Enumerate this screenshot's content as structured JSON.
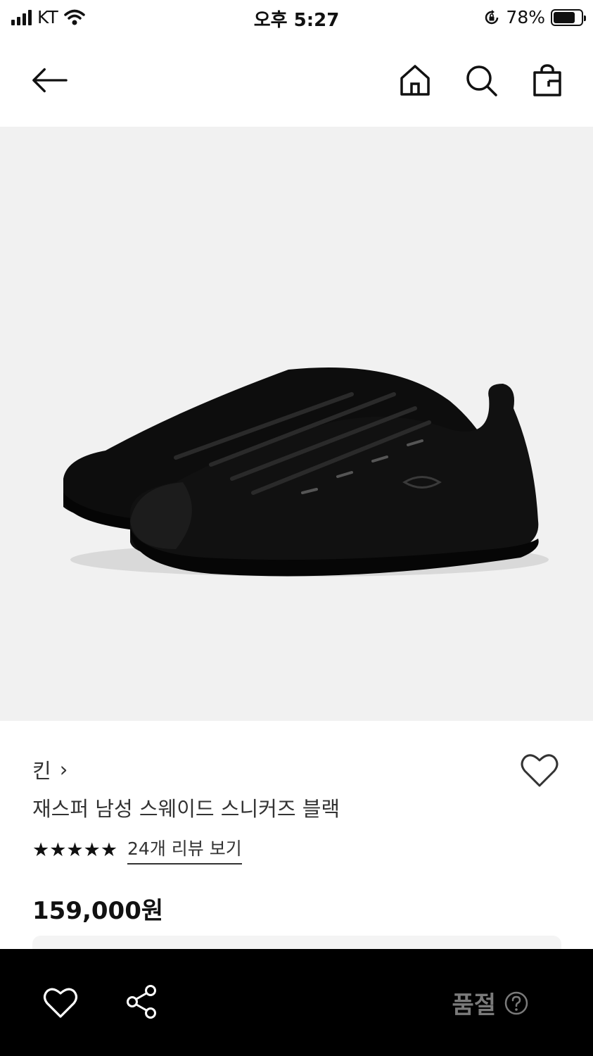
{
  "status_bar": {
    "carrier": "KT",
    "time": "오후 5:27",
    "battery_percent": "78%",
    "battery_level": 0.78,
    "icons": [
      "signal-icon",
      "wifi-icon",
      "rotation-lock-icon",
      "battery-icon"
    ]
  },
  "nav": {
    "icons": [
      "back-arrow-icon",
      "home-icon",
      "search-icon",
      "shopping-bag-icon"
    ]
  },
  "product": {
    "brand": "킨",
    "brand_chevron": "›",
    "name": "재스퍼 남성 스웨이드 스니커즈 블랙",
    "stars": "★★★★★",
    "rating_value": 5,
    "review_link": "24개 리뷰 보기",
    "price": "159,000원"
  },
  "bottom_bar": {
    "status_label": "품절",
    "icons": [
      "heart-icon",
      "share-icon",
      "help-icon"
    ]
  },
  "colors": {
    "hero_background": "#f1f1f1",
    "bottom_bar_background": "#000000",
    "soldout_text": "#7a7a7a"
  }
}
